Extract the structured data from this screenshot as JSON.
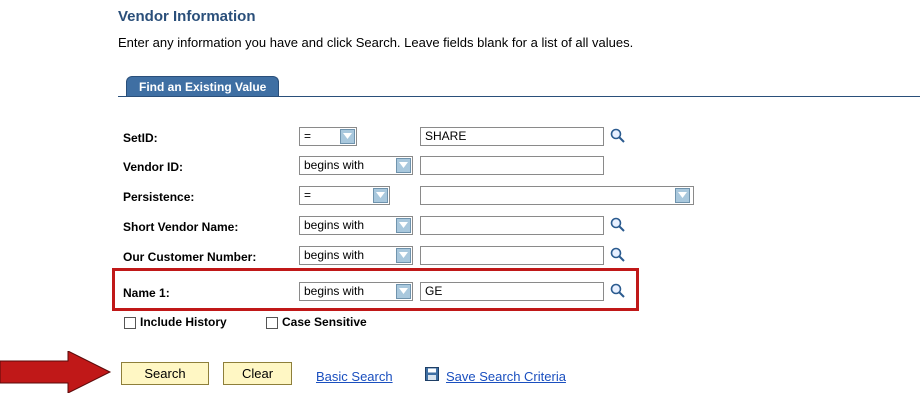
{
  "page": {
    "title": "Vendor Information",
    "instructions": "Enter any information you have and click Search. Leave fields blank for a list of all values."
  },
  "tab": {
    "label": "Find an Existing Value"
  },
  "fields": [
    {
      "label": "SetID:",
      "operator": "=",
      "value": "SHARE"
    },
    {
      "label": "Vendor ID:",
      "operator": "begins with",
      "value": ""
    },
    {
      "label": "Persistence:",
      "operator": "=",
      "value": ""
    },
    {
      "label": "Short Vendor Name:",
      "operator": "begins with",
      "value": ""
    },
    {
      "label": "Our Customer Number:",
      "operator": "begins with",
      "value": ""
    },
    {
      "label": "Name 1:",
      "operator": "begins with",
      "value": "GE"
    }
  ],
  "options": {
    "include_history": "Include History",
    "case_sensitive": "Case Sensitive"
  },
  "buttons": {
    "search": "Search",
    "clear": "Clear"
  },
  "links": {
    "basic_search": "Basic Search",
    "save_criteria": "Save Search Criteria"
  },
  "colors": {
    "highlight_box": "#c01818",
    "arrow": "#c01818",
    "tab": "#3f6fa3",
    "button": "#fff7c4"
  }
}
